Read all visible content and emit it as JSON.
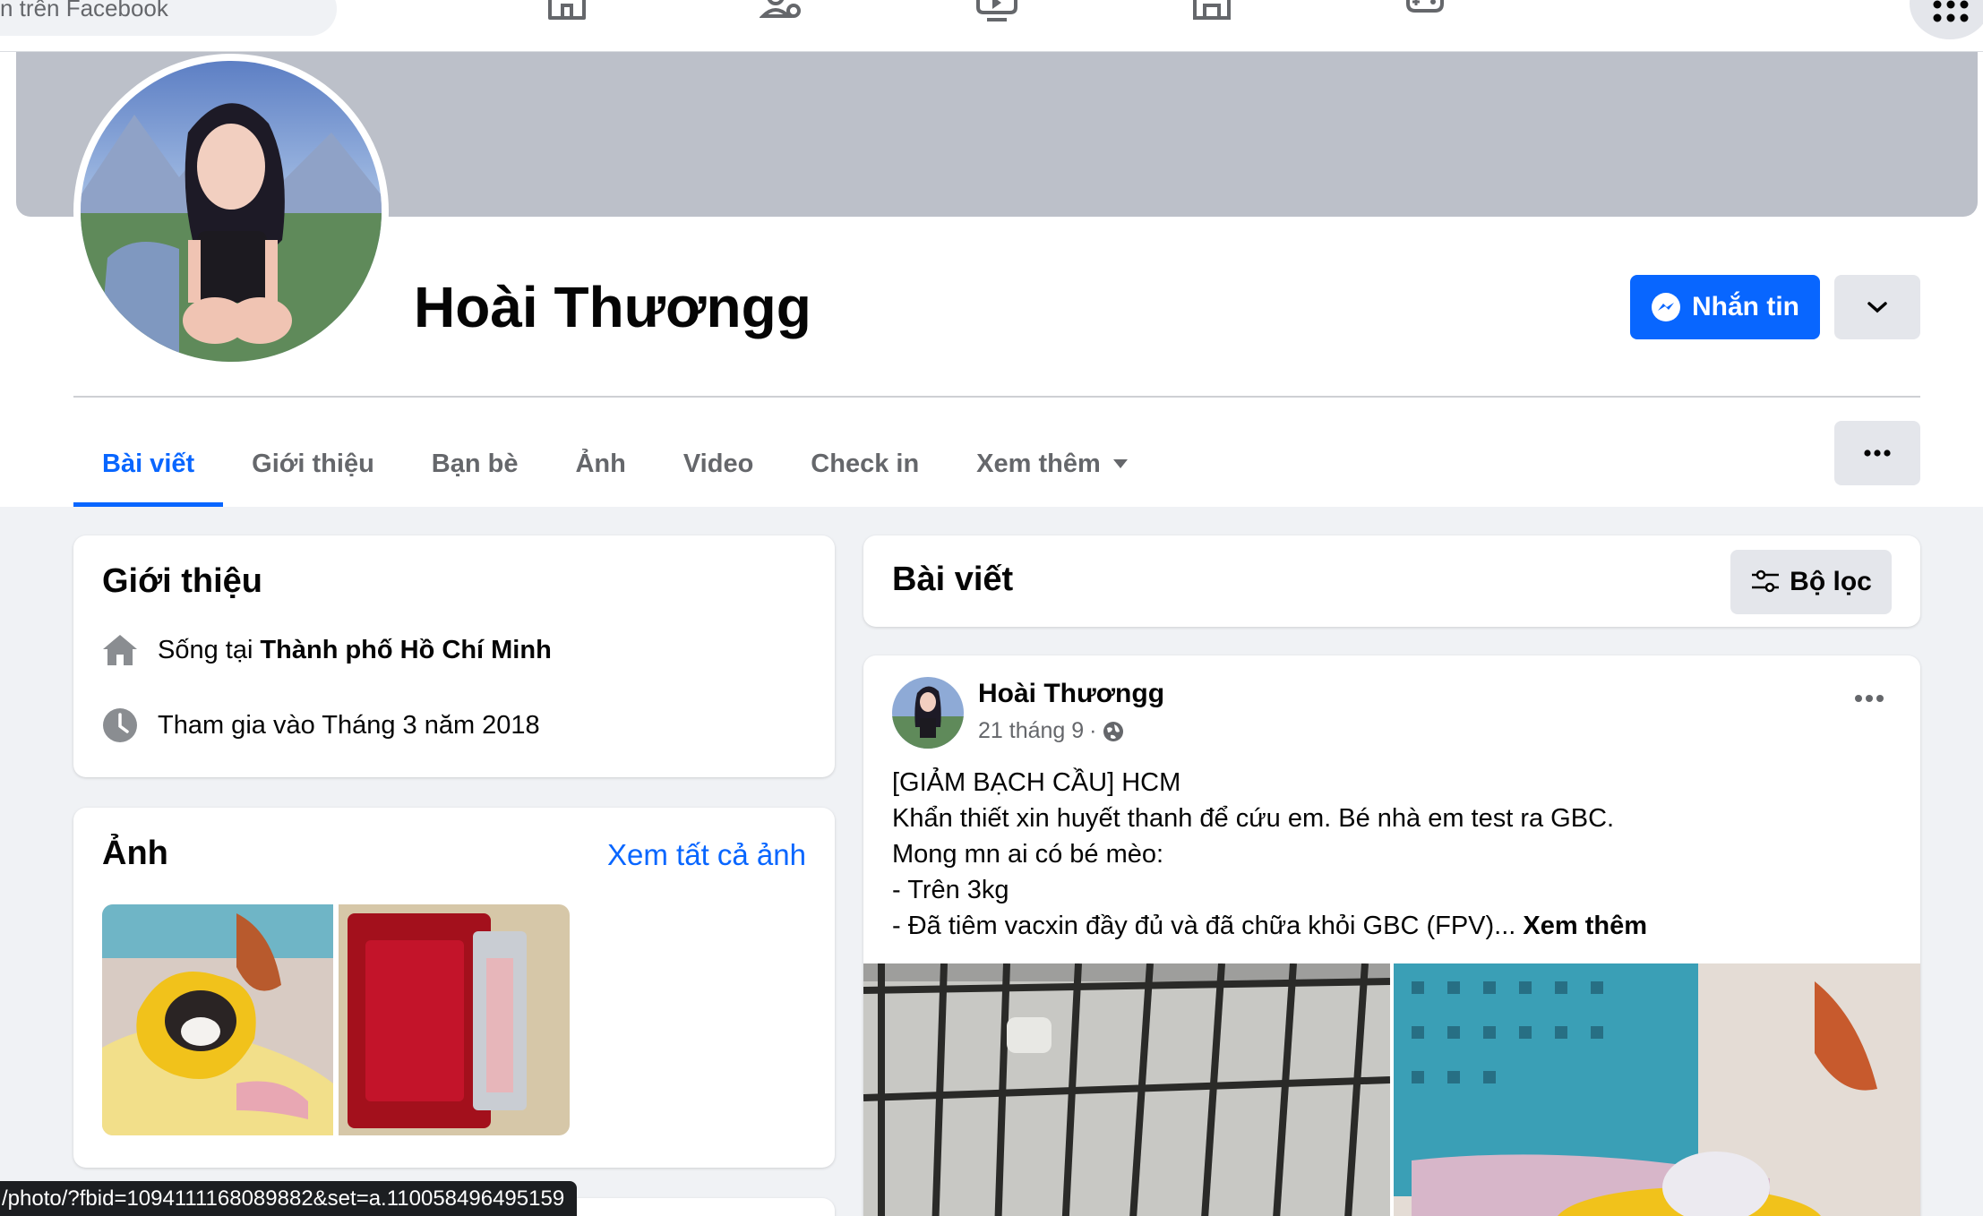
{
  "topbar": {
    "search_placeholder": "n trên Facebook",
    "nav_icons": [
      "home-icon",
      "friends-icon",
      "video-icon",
      "marketplace-icon",
      "gaming-icon"
    ],
    "apps_icon": "menu-grid-icon"
  },
  "profile": {
    "name": "Hoài Thươngg",
    "message_button": "Nhắn tin"
  },
  "tabs": [
    {
      "label": "Bài viết",
      "active": true
    },
    {
      "label": "Giới thiệu"
    },
    {
      "label": "Bạn bè"
    },
    {
      "label": "Ảnh"
    },
    {
      "label": "Video"
    },
    {
      "label": "Check in"
    },
    {
      "label": "Xem thêm"
    }
  ],
  "intro": {
    "title": "Giới thiệu",
    "lives_prefix": "Sống tại ",
    "lives_city": "Thành phố Hồ Chí Minh",
    "joined": "Tham gia vào Tháng 3 năm 2018"
  },
  "photos": {
    "title": "Ảnh",
    "see_all": "Xem tất cả ảnh"
  },
  "posts_header": {
    "title": "Bài viết",
    "filter_label": "Bộ lọc"
  },
  "post": {
    "author": "Hoài Thươngg",
    "date": "21 tháng 9",
    "separator": "·",
    "lines": [
      "[GIẢM BẠCH CẦU] HCM",
      "Khẩn thiết xin huyết thanh để cứu em. Bé nhà em test ra GBC.",
      "Mong mn ai có bé mèo:",
      "- Trên 3kg",
      "- Đã tiêm vacxin đầy đủ và đã chữa khỏi GBC (FPV)... "
    ],
    "see_more": "Xem thêm"
  },
  "status_bar": {
    "url": "/photo/?fbid=1094111168089882&set=a.110058496495159"
  },
  "colors": {
    "accent": "#0866ff",
    "background": "#f0f2f5",
    "cover": "#bcc0c9"
  }
}
